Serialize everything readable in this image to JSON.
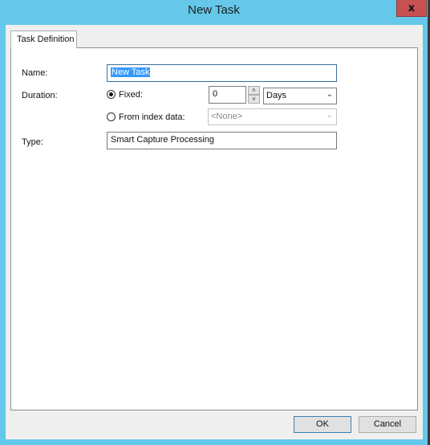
{
  "window": {
    "title": "New Task",
    "close_glyph": "x"
  },
  "tabs": [
    {
      "label": "Task Definition",
      "active": true
    }
  ],
  "form": {
    "name_label": "Name:",
    "name_value": "New Task",
    "duration_label": "Duration:",
    "fixed_label": "Fixed:",
    "fixed_selected": true,
    "fixed_value": "0",
    "spin_up": "˄",
    "spin_down": "˅",
    "unit_value": "Days",
    "index_label": "From index data:",
    "index_selected": false,
    "index_value": "<None>",
    "type_label": "Type:",
    "type_value": "Smart Capture Processing",
    "dropdown_glyph": "⌄"
  },
  "buttons": {
    "ok": "OK",
    "cancel": "Cancel"
  }
}
